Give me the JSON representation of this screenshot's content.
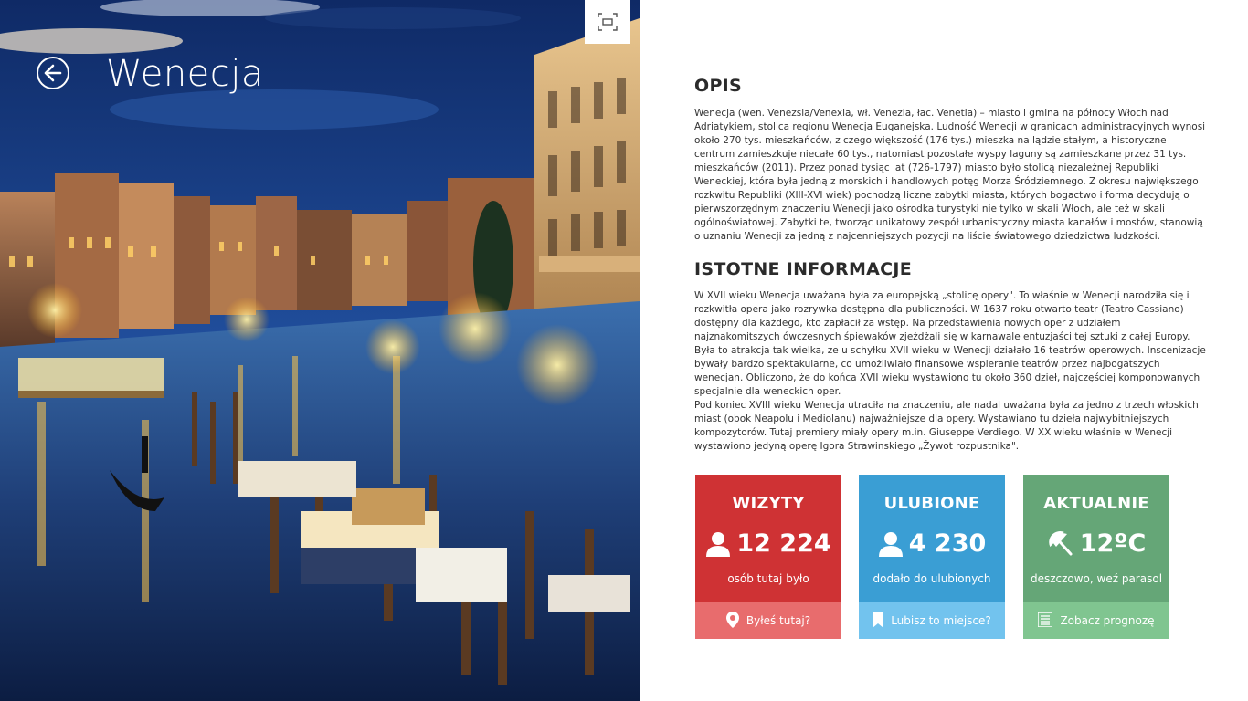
{
  "header": {
    "title": "Wenecja",
    "back_icon": "arrow-left-icon",
    "fullscreen_icon": "fullscreen-icon"
  },
  "sections": {
    "opis": {
      "title": "OPIS",
      "text": "Wenecja (wen. Venezsia/Venexia, wł. Venezia, łac. Venetia) – miasto i gmina na północy Włoch nad Adriatykiem, stolica regionu Wenecja Euganejska. Ludność Wenecji w granicach administracyjnych wynosi około 270 tys. mieszkańców, z czego większość (176 tys.) mieszka na lądzie stałym, a historyczne centrum zamieszkuje niecałe 60 tys., natomiast pozostałe wyspy laguny są zamieszkane przez 31 tys. mieszkańców (2011). Przez ponad tysiąc lat (726-1797) miasto było stolicą niezależnej Republiki Weneckiej, która była jedną z morskich i handlowych potęg Morza Śródziemnego. Z okresu największego rozkwitu Republiki (XIII-XVI wiek) pochodzą liczne zabytki miasta, których bogactwo i forma decydują o pierwszorzędnym znaczeniu Wenecji jako ośrodka turystyki nie tylko w skali Włoch, ale też w skali ogólnoświatowej. Zabytki te, tworząc unikatowy zespół urbanistyczny miasta kanałów i mostów, stanowią o uznaniu Wenecji za jedną z najcenniejszych pozycji na liście światowego dziedzictwa ludzkości."
    },
    "istotne": {
      "title": "ISTOTNE INFORMACJE",
      "paragraph1": "W XVII wieku Wenecja uważana była za europejską „stolicę opery\". To właśnie w Wenecji narodziła się i rozkwitła opera jako rozrywka dostępna dla publiczności. W 1637 roku otwarto teatr (Teatro Cassiano) dostępny dla każdego, kto zapłacił za wstęp. Na przedstawienia nowych oper z udziałem najznakomitszych ówczesnych śpiewaków zjeżdżali się w karnawale entuzjaści tej sztuki z całej Europy. Była to atrakcja tak wielka, że u schyłku XVII wieku w Wenecji działało 16 teatrów operowych. Inscenizacje bywały bardzo spektakularne, co umożliwiało finansowe wspieranie teatrów przez najbogatszych wenecjan. Obliczono, że do końca XVII wieku wystawiono tu około 360 dzieł, najczęściej komponowanych specjalnie dla weneckich oper.",
      "paragraph2": "Pod koniec XVIII wieku Wenecja utraciła na znaczeniu, ale nadal uważana była za jedno z trzech włoskich miast (obok Neapolu i Mediolanu) najważniejsze dla opery. Wystawiano tu dzieła najwybitniejszych kompozytorów. Tutaj premiery miały opery m.in. Giuseppe Verdiego. W XX wieku właśnie w Wenecji wystawiono jedyną operę Igora Strawinskiego „Żywot rozpustnika\"."
    }
  },
  "tiles": [
    {
      "title": "WIZYTY",
      "value": "12 224",
      "value_icon": "person-icon",
      "subtitle": "osób tutaj było",
      "action_label": "Byłeś tutaj?",
      "action_icon": "map-pin-icon",
      "color": "#cf3234",
      "action_color": "#e86c6d"
    },
    {
      "title": "ULUBIONE",
      "value": "4 230",
      "value_icon": "person-icon",
      "subtitle": "dodało do ulubionych",
      "action_label": "Lubisz to miejsce?",
      "action_icon": "bookmark-icon",
      "color": "#3a9ed4",
      "action_color": "#72c3ee"
    },
    {
      "title": "AKTUALNIE",
      "value": "12ºC",
      "value_icon": "umbrella-icon",
      "subtitle": "deszczowo, weź parasol",
      "action_label": "Zobacz prognozę",
      "action_icon": "list-icon",
      "color": "#65a677",
      "action_color": "#80c590"
    }
  ]
}
